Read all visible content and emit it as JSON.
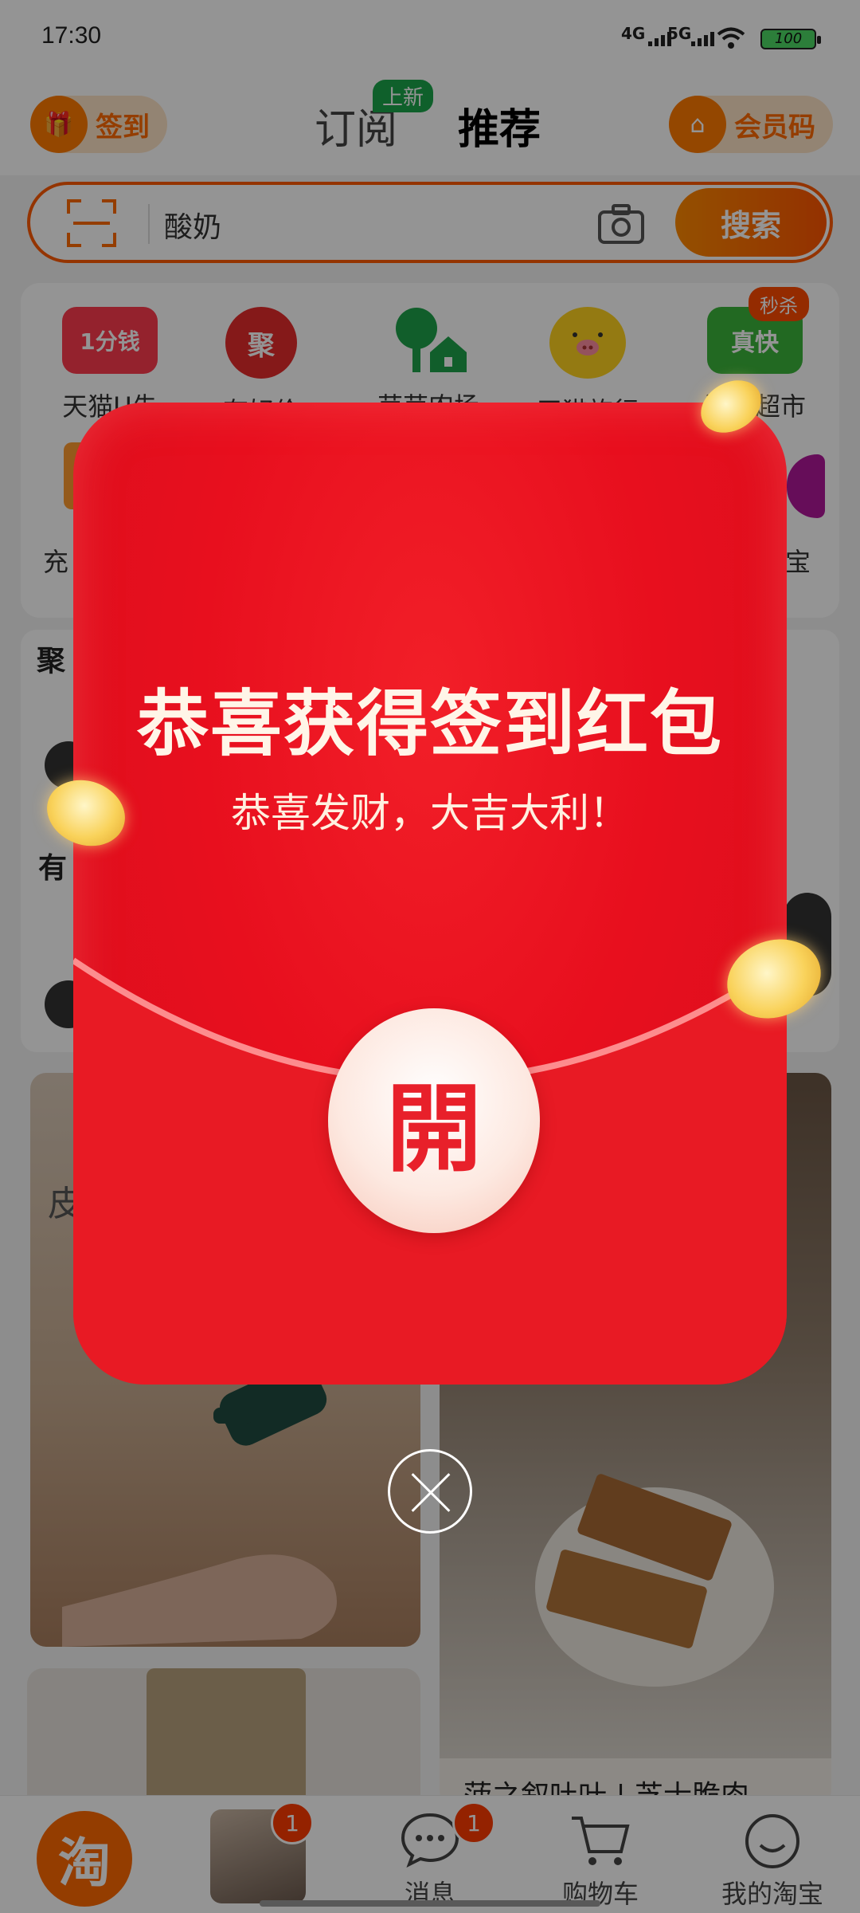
{
  "status_bar": {
    "time": "17:30",
    "network1": "4G",
    "network2": "5G",
    "battery": "100"
  },
  "header": {
    "checkin_label": "签到",
    "tab_subscribe": "订阅",
    "tab_subscribe_badge": "上新",
    "tab_recommend": "推荐",
    "member_label": "会员码"
  },
  "search": {
    "query": "酸奶",
    "button": "搜索"
  },
  "grid": {
    "items": [
      {
        "label": "天猫U先",
        "icon_text": "1分钱",
        "color": "#ff3b4e"
      },
      {
        "label": "有好价",
        "icon_text": "聚",
        "color": "#e62b2b"
      },
      {
        "label": "芭芭农场",
        "icon_text": "",
        "color": "#1ea34a"
      },
      {
        "label": "天猫旅行",
        "icon_text": "",
        "color": "#ffd21f"
      },
      {
        "label": "淘鲜超市",
        "icon_text": "真快",
        "color": "#3cb53c"
      }
    ],
    "row2_left": "充",
    "row2_right": "宝",
    "flash_tag": "秒杀"
  },
  "feed": {
    "section_title": "聚",
    "section_sub": "有",
    "card_left_title": "皮",
    "card_right_title": "菠之叙吐叶 | 芝士脆肉"
  },
  "tabbar": {
    "logo": "淘",
    "video_badge": "1",
    "messages_label": "消息",
    "messages_badge": "1",
    "cart_label": "购物车",
    "mine_label": "我的淘宝"
  },
  "popup": {
    "title": "恭喜获得签到红包",
    "subtitle": "恭喜发财，大吉大利！",
    "open_label": "開"
  }
}
